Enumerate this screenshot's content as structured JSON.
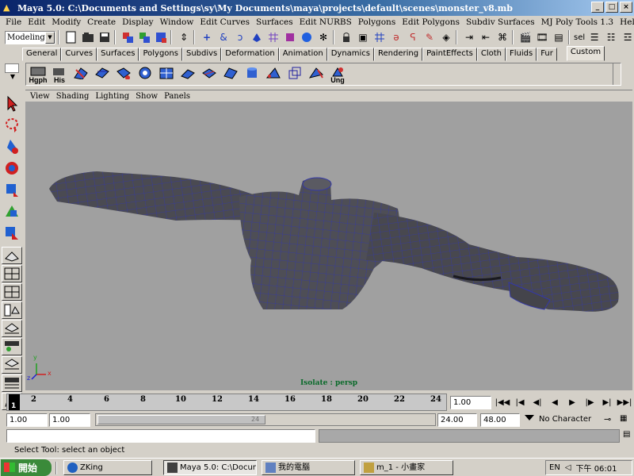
{
  "window": {
    "title": "Maya 5.0: C:\\Documents and Settings\\sy\\My Documents\\maya\\projects\\default\\scenes\\monster_v8.mb",
    "minimize": "_",
    "maximize": "□",
    "close": "×"
  },
  "menu": [
    "File",
    "Edit",
    "Modify",
    "Create",
    "Display",
    "Window",
    "Edit Curves",
    "Surfaces",
    "Edit NURBS",
    "Polygons",
    "Edit Polygons",
    "Subdiv Surfaces",
    "MJ Poly Tools 1.3",
    "Help"
  ],
  "statusline": {
    "mode": "Modeling",
    "sel_label": "sel"
  },
  "shelf_tabs": [
    "General",
    "Curves",
    "Surfaces",
    "Polygons",
    "Subdivs",
    "Deformation",
    "Animation",
    "Dynamics",
    "Rendering",
    "PaintEffects",
    "Cloth",
    "Fluids",
    "Fur",
    "Custom"
  ],
  "shelf_active_tab": "Custom",
  "shelf_labels": {
    "hgph": "Hgph",
    "his": "His",
    "ung": "Ung"
  },
  "panel_menu": [
    "View",
    "Shading",
    "Lighting",
    "Show",
    "Panels"
  ],
  "viewport": {
    "label": "Isolate : persp",
    "axes": {
      "x": "x",
      "y": "y",
      "z": "z"
    }
  },
  "timeline": {
    "ticks": [
      "2",
      "4",
      "6",
      "8",
      "10",
      "12",
      "14",
      "16",
      "18",
      "20",
      "22",
      "24"
    ],
    "current_frame_marker": "1",
    "current_frame": "1.00"
  },
  "range": {
    "start": "1.00",
    "range_start": "1.00",
    "slider_value": "24",
    "end": "24.00",
    "range_end": "48.00",
    "character_set": "No Character Set"
  },
  "helpline": "Select Tool: select an object",
  "taskbar": {
    "start": "開始",
    "items": [
      "ZKing",
      "Maya 5.0: C:\\Docume...",
      "我的電腦",
      "m_1 - 小畫家"
    ],
    "lang": "EN",
    "clock": "下午 06:01"
  }
}
